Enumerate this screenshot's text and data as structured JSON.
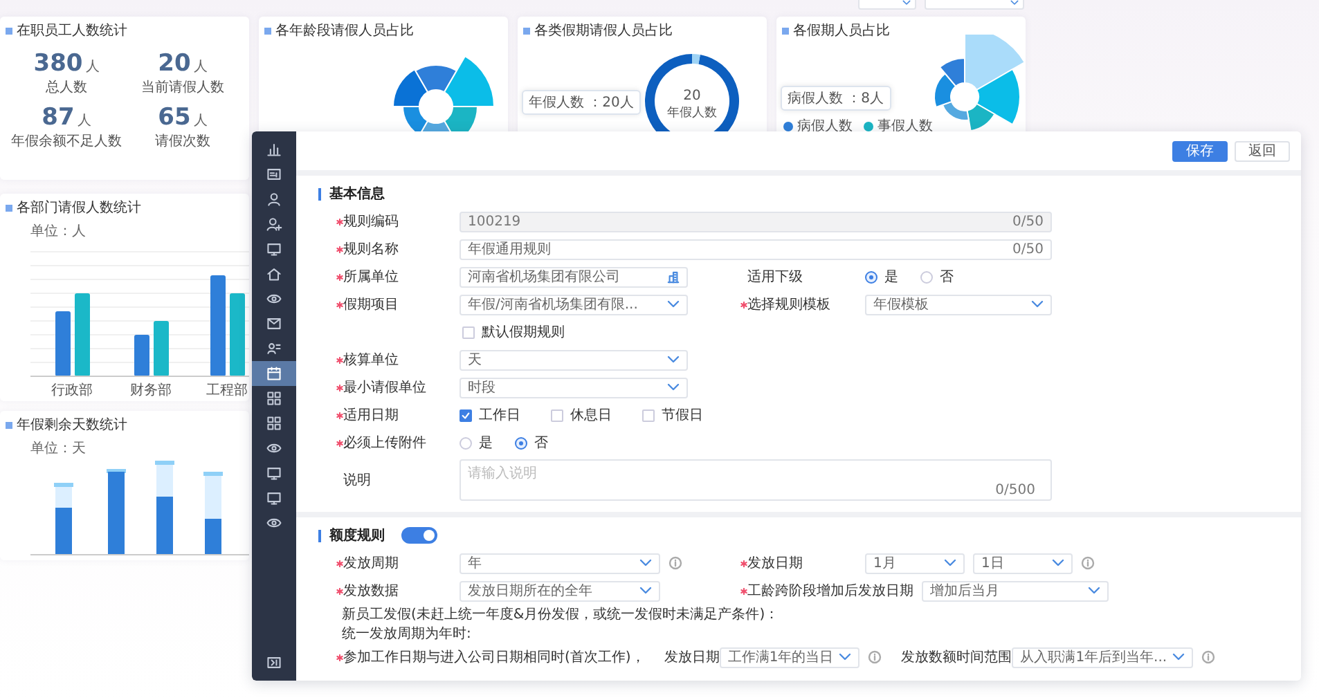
{
  "dashboard": {
    "stat_card": {
      "title": "在职员工人数统计",
      "stats": [
        {
          "value": "380",
          "unit": "人",
          "label": "总人数"
        },
        {
          "value": "20",
          "unit": "人",
          "label": "当前请假人数"
        },
        {
          "value": "87",
          "unit": "人",
          "label": "年假余额不足人数"
        },
        {
          "value": "65",
          "unit": "人",
          "label": "请假次数"
        }
      ]
    },
    "chart_cards": [
      {
        "kind": "rose",
        "title": "各年龄段请假人员占比"
      },
      {
        "kind": "donut",
        "title": "各类假期请假人员占比",
        "callout": "年假人数 ：20人",
        "center_value": "20",
        "center_label": "年假人数"
      },
      {
        "kind": "rose-legend",
        "title": "各假期人员占比",
        "callout": "病假人数 ：8人",
        "legend": [
          {
            "label": "病假人数",
            "color": "#2f7fd9"
          },
          {
            "label": "事假人数",
            "color": "#1bb5c4"
          }
        ]
      }
    ],
    "bar_card": {
      "title": "各部门请假人数统计",
      "unit": "单位：人",
      "categories": [
        "行政部",
        "财务部",
        "工程部"
      ]
    },
    "stack_card": {
      "title": "年假剩余天数统计",
      "unit": "单位：天"
    }
  },
  "editor": {
    "sidebar": {
      "items": [
        {
          "selected": false
        },
        {
          "selected": false
        },
        {
          "selected": false
        },
        {
          "selected": false
        },
        {
          "selected": false
        },
        {
          "selected": false
        },
        {
          "selected": false
        },
        {
          "selected": false
        },
        {
          "selected": false
        },
        {
          "selected": true
        },
        {
          "selected": false
        },
        {
          "selected": false
        },
        {
          "selected": false
        },
        {
          "selected": false
        },
        {
          "selected": false
        },
        {
          "selected": false
        }
      ]
    },
    "buttons": [
      {
        "label": "保存",
        "kind": "primary"
      },
      {
        "label": "返回",
        "kind": "default"
      }
    ],
    "sections": [
      {
        "title": "基本信息",
        "rows": [
          {
            "kind": "fields",
            "fields": [
              {
                "label": "规则编码",
                "required": true,
                "kind": "text",
                "value": "100219",
                "counter": "0/50",
                "disabled": true
              }
            ]
          },
          {
            "kind": "fields",
            "fields": [
              {
                "label": "规则名称",
                "required": true,
                "kind": "text",
                "value": "年假通用规则",
                "counter": "0/50",
                "disabled": false
              }
            ]
          },
          {
            "kind": "fields",
            "fields": [
              {
                "label": "所属单位",
                "required": true,
                "kind": "picker",
                "value": "河南省机场集团有限公司"
              },
              {
                "label": "适用下级",
                "required": false,
                "kind": "radio",
                "options": [
                  {
                    "label": "是",
                    "selected": true
                  },
                  {
                    "label": "否",
                    "selected": false
                  }
                ]
              }
            ]
          },
          {
            "kind": "fields",
            "fields": [
              {
                "label": "假期项目",
                "required": true,
                "kind": "select",
                "value": "年假/河南省机场集团有限..."
              },
              {
                "label": "选择规则模板",
                "required": true,
                "kind": "select",
                "value": "年假模板"
              }
            ]
          },
          {
            "kind": "fields",
            "fields": [
              {
                "kind": "checkbox",
                "text": "默认假期规则",
                "checked": false
              }
            ]
          },
          {
            "kind": "fields",
            "fields": [
              {
                "label": "核算单位",
                "required": true,
                "kind": "select",
                "value": "天"
              }
            ]
          },
          {
            "kind": "fields",
            "fields": [
              {
                "label": "最小请假单位",
                "required": true,
                "kind": "select",
                "value": "时段"
              }
            ]
          },
          {
            "kind": "fields",
            "fields": [
              {
                "label": "适用日期",
                "required": true,
                "kind": "checkgroup",
                "options": [
                  {
                    "label": "工作日",
                    "checked": true
                  },
                  {
                    "label": "休息日",
                    "checked": false
                  },
                  {
                    "label": "节假日",
                    "checked": false
                  }
                ]
              }
            ]
          },
          {
            "kind": "fields",
            "fields": [
              {
                "label": "必须上传附件",
                "required": true,
                "kind": "radio",
                "options": [
                  {
                    "label": "是",
                    "selected": false
                  },
                  {
                    "label": "否",
                    "selected": true
                  }
                ]
              }
            ]
          },
          {
            "kind": "fields",
            "fields": [
              {
                "label": "说明",
                "required": false,
                "kind": "textarea",
                "placeholder": "请输入说明",
                "counter": "0/500"
              }
            ]
          }
        ]
      },
      {
        "title": "额度规则",
        "switch": {
          "on": true
        },
        "rows": [
          {
            "kind": "fields",
            "fields": [
              {
                "label": "发放周期",
                "required": true,
                "kind": "select",
                "value": "年",
                "info": true
              },
              {
                "label": "发放日期",
                "required": true,
                "kind": "selects",
                "values": [
                  "1月",
                  "1日"
                ],
                "info": true
              }
            ]
          },
          {
            "kind": "fields",
            "fields": [
              {
                "label": "发放数据",
                "required": true,
                "kind": "select",
                "value": "发放日期所在的全年"
              },
              {
                "label": "工龄跨阶段增加后发放日期",
                "required": true,
                "kind": "select",
                "value": "增加后当月"
              }
            ]
          },
          {
            "kind": "text",
            "text": "新员工发假(未赶上统一年度&月份发假，或统一发假时未满足产条件)："
          },
          {
            "kind": "text",
            "text": "统一发放周期为年时:"
          },
          {
            "kind": "inline",
            "fields": [
              {
                "label": "参加工作日期与进入公司日期相同时(首次工作)，",
                "required": true,
                "kind": "note"
              },
              {
                "label": "发放日期",
                "required": false,
                "kind": "select",
                "value": "工作满1年的当日",
                "info": true
              },
              {
                "label": "发放数额时间范围",
                "required": false,
                "kind": "select",
                "value": "从入职满1年后到当年...",
                "info": true
              }
            ]
          }
        ]
      }
    ]
  }
}
